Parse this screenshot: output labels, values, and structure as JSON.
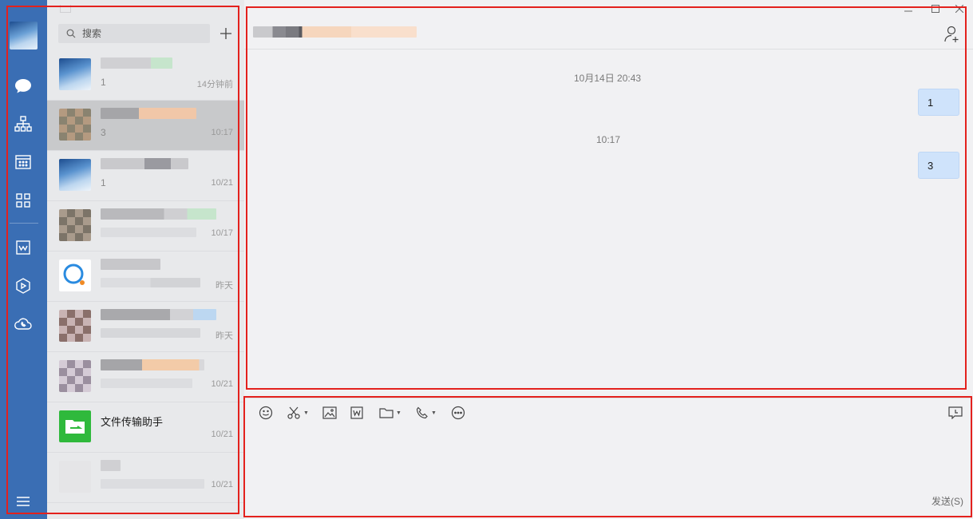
{
  "search": {
    "placeholder": "搜索"
  },
  "sessions": [
    {
      "preview": "1",
      "time": "14分钟前"
    },
    {
      "preview": "3",
      "time": "10:17"
    },
    {
      "preview": "1",
      "time": "10/21"
    },
    {
      "preview": "",
      "time": "10/17"
    },
    {
      "preview": "",
      "time": "昨天"
    },
    {
      "preview": "",
      "time": "昨天"
    },
    {
      "preview": "",
      "time": "10/21"
    },
    {
      "name": "文件传输助手",
      "preview": "",
      "time": "10/21"
    },
    {
      "preview": "",
      "time": "10/21"
    }
  ],
  "chat": {
    "messages": [
      {
        "time_separator": "10月14日 20:43",
        "text": "1"
      },
      {
        "time_separator": "10:17",
        "text": "3"
      }
    ],
    "send_label": "发送(S)"
  },
  "icons": {
    "rail": [
      "chat-icon",
      "org-icon",
      "calendar-icon",
      "apps-icon",
      "document-icon",
      "drive-icon",
      "cloud-phone-icon",
      "menu-icon"
    ],
    "toolbar": [
      "emoji-icon",
      "scissors-icon",
      "image-icon",
      "word-doc-icon",
      "folder-icon",
      "phone-icon",
      "more-icon",
      "chat-history-icon"
    ]
  },
  "colors": {
    "rail": "#3a6eb4",
    "bubble": "#cfe3fb",
    "annotation": "#e3211d",
    "file_helper": "#2fb93c"
  }
}
